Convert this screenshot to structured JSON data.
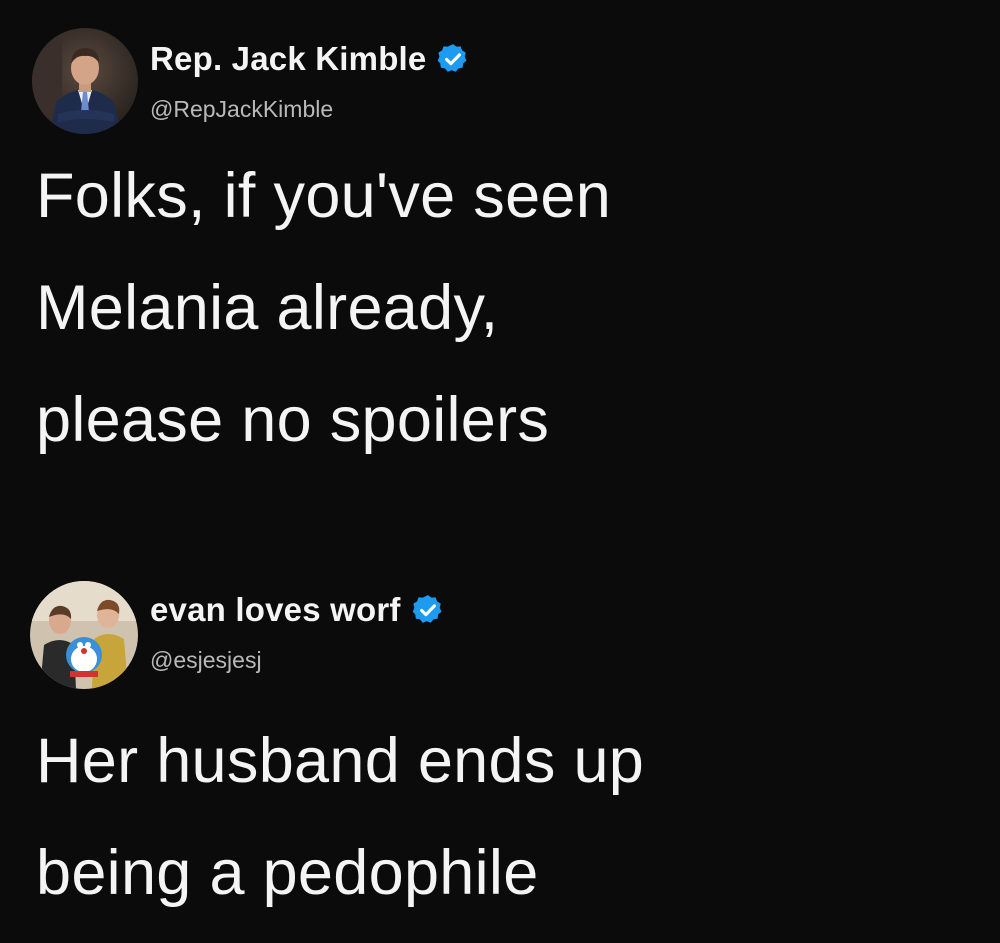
{
  "tweets": [
    {
      "display_name": "Rep. Jack Kimble",
      "handle": "@RepJackKimble",
      "verified": true,
      "text": "Folks, if you've seen\nMelania already,\nplease no spoilers",
      "avatar": "man-in-suit-avatar"
    },
    {
      "display_name": "evan loves worf",
      "handle": "@esjesjesj",
      "verified": true,
      "text": "Her husband ends up\nbeing a pedophile",
      "avatar": "group-photo-avatar"
    }
  ],
  "colors": {
    "background": "#0b0b0b",
    "text": "#f4f4f4",
    "handle": "#b9b9b9",
    "verified_blue": "#1d9bf0"
  }
}
